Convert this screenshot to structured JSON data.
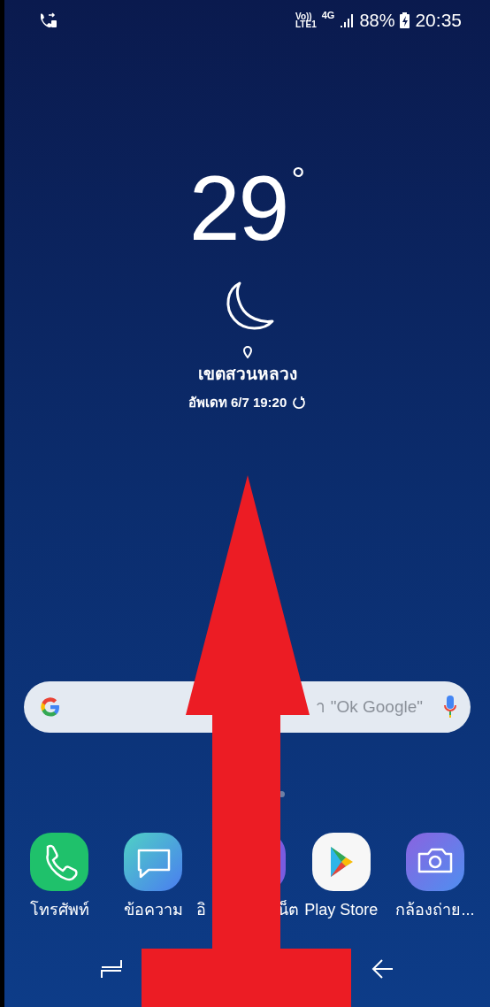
{
  "status_bar": {
    "volte_top": "Vo))",
    "volte_bottom": "LTE1",
    "network": "4G",
    "battery": "88%",
    "time": "20:35"
  },
  "weather": {
    "temperature": "29",
    "unit": "°",
    "location": "เขตสวนหลวง",
    "updated": "อัพเดท 6/7 19:20"
  },
  "search": {
    "placeholder": "า \"Ok Google\""
  },
  "dock": [
    {
      "kind": "phone",
      "label": "โทรศัพท์"
    },
    {
      "kind": "messages",
      "label": "ข้อความ"
    },
    {
      "kind": "internet",
      "label_start": "อิ",
      "label_end": "น็ต"
    },
    {
      "kind": "play",
      "label": "Play Store"
    },
    {
      "kind": "camera",
      "label": "กล้องถ่าย..."
    }
  ]
}
